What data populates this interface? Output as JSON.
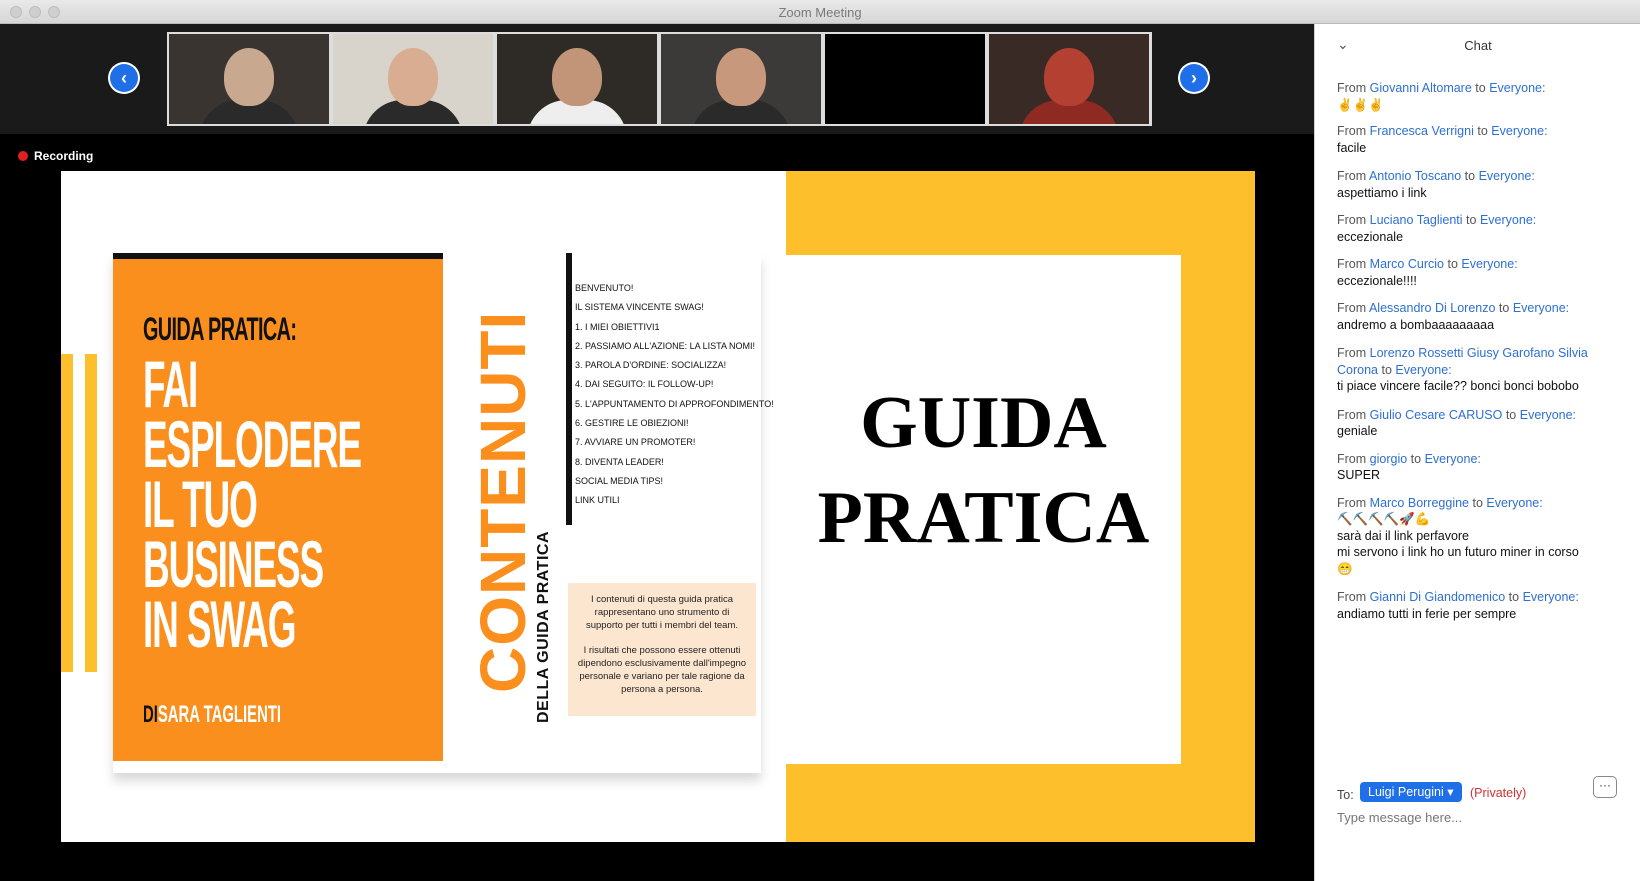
{
  "window": {
    "title": "Zoom Meeting"
  },
  "gallery": {
    "prev_icon": "chevron-left-icon",
    "next_icon": "chevron-right-icon",
    "prev_glyph": "‹",
    "next_glyph": "›",
    "thumbnails": [
      {
        "bg": "#3a3430",
        "person": "#c9a890"
      },
      {
        "bg": "#d8d4cc",
        "person": "#d8ad92"
      },
      {
        "bg": "#2e2a26",
        "person": "#c29578"
      },
      {
        "bg": "#3b3a38",
        "person": "#c7987b"
      },
      {
        "bg": "#000000",
        "person": ""
      },
      {
        "bg": "#3a2a26",
        "person": "#b44032"
      }
    ]
  },
  "recording": {
    "label": "Recording"
  },
  "slide": {
    "cover": {
      "subtitle": "GUIDA PRATICA:",
      "lines": [
        "FAI",
        "ESPLODERE",
        "IL TUO",
        "BUSINESS",
        "IN SWAG"
      ],
      "by_prefix": "DI",
      "author": "SARA TAGLIENTI"
    },
    "contenuti": "CONTENUTI",
    "della": "DELLA GUIDA PRATICA",
    "toc": [
      "BENVENUTO!",
      "IL SISTEMA VINCENTE SWAG!",
      "1. I MIEI OBIETTIVI1",
      "2. PASSIAMO ALL'AZIONE: LA LISTA NOMI!",
      "3. PAROLA D'ORDINE: SOCIALIZZA!",
      "4. DAI SEGUITO: IL FOLLOW-UP!",
      "5. L'APPUNTAMENTO DI APPROFONDIMENTO!",
      "6. GESTIRE LE OBIEZIONI!",
      "7. AVVIARE UN PROMOTER!",
      "8. DIVENTA LEADER!",
      "SOCIAL MEDIA TIPS!",
      "LINK UTILI"
    ],
    "note_p1": "I contenuti di questa guida pratica rappresentano uno strumento di supporto per tutti i membri del team.",
    "note_p2": "I risultati che possono essere ottenuti dipendono esclusivamente dall'impegno personale e variano per tale ragione da persona a persona.",
    "big_title_1": "GUIDA",
    "big_title_2": "PRATICA"
  },
  "chat": {
    "title": "Chat",
    "collapse_glyph": "⌄",
    "messages": [
      {
        "from": "From",
        "sender": "Giovanni Altomare",
        "to_word": "to",
        "recipient": "Everyone:",
        "body": "✌️✌️✌️"
      },
      {
        "from": "From",
        "sender": "Francesca Verrigni",
        "to_word": "to",
        "recipient": "Everyone:",
        "body": "facile"
      },
      {
        "from": "From",
        "sender": "Antonio Toscano",
        "to_word": "to",
        "recipient": "Everyone:",
        "body": "aspettiamo i link"
      },
      {
        "from": "From",
        "sender": "Luciano Taglienti",
        "to_word": "to",
        "recipient": "Everyone:",
        "body": "eccezionale"
      },
      {
        "from": "From",
        "sender": "Marco Curcio",
        "to_word": "to",
        "recipient": "Everyone:",
        "body": "eccezionale!!!!"
      },
      {
        "from": "From",
        "sender": "Alessandro Di Lorenzo",
        "to_word": "to",
        "recipient": "Everyone:",
        "body": "andremo a bombaaaaaaaaa"
      },
      {
        "from": "From",
        "sender": "Lorenzo Rossetti Giusy Garofano Silvia Corona",
        "to_word": "to",
        "recipient": "Everyone:",
        "body": "ti piace vincere facile?? bonci bonci bobobo"
      },
      {
        "from": "From",
        "sender": "Giulio Cesare CARUSO",
        "to_word": "to",
        "recipient": "Everyone:",
        "body": "geniale"
      },
      {
        "from": "From",
        "sender": "giorgio",
        "to_word": "to",
        "recipient": "Everyone:",
        "body": "SUPER"
      },
      {
        "from": "From",
        "sender": "Marco Borreggine",
        "to_word": "to",
        "recipient": "Everyone:",
        "body": "⛏️⛏️⛏️⛏️🚀💪\nsarà dai il link perfavore\nmi servono i link ho un futuro miner in corso\n😁"
      },
      {
        "from": "From",
        "sender": "Gianni Di Giandomenico",
        "to_word": "to",
        "recipient": "Everyone:",
        "body": "andiamo tutti in ferie per sempre"
      }
    ],
    "footer": {
      "to_label": "To:",
      "recipient": "Luigi Perugini",
      "dropdown_glyph": "▾",
      "privately": "(Privately)",
      "more": "···",
      "placeholder": "Type message here..."
    }
  }
}
